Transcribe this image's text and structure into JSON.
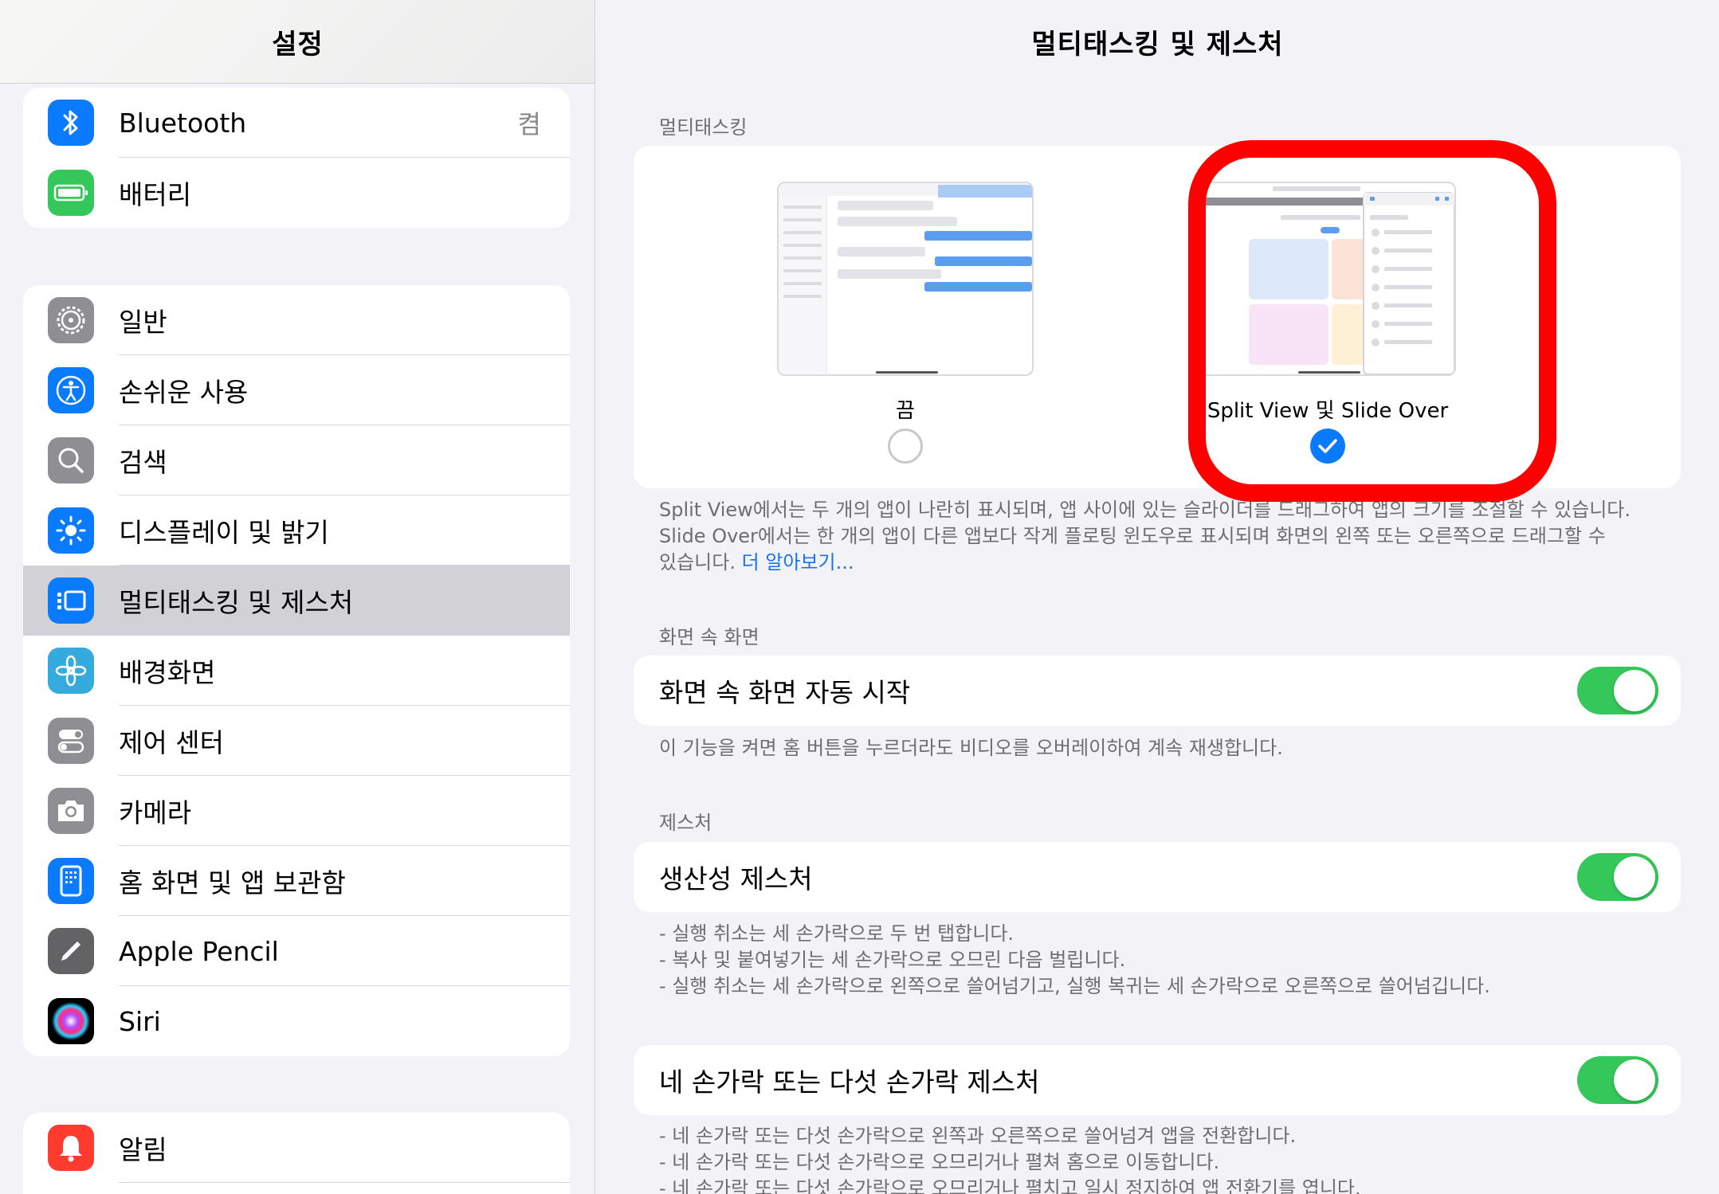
{
  "sidebar": {
    "title": "설정",
    "group1": [
      {
        "label": "Bluetooth",
        "value": "켬",
        "icon": "bluetooth-icon",
        "color": "#0a7aff"
      },
      {
        "label": "배터리",
        "icon": "battery-icon",
        "color": "#34c759"
      }
    ],
    "group2": [
      {
        "label": "일반",
        "icon": "gear-icon",
        "color": "#8e8e93"
      },
      {
        "label": "손쉬운 사용",
        "icon": "accessibility-icon",
        "color": "#0a7aff"
      },
      {
        "label": "검색",
        "icon": "search-icon",
        "color": "#8e8e93"
      },
      {
        "label": "디스플레이 및 밝기",
        "icon": "sun-icon",
        "color": "#0a7aff"
      },
      {
        "label": "멀티태스킹 및 제스처",
        "icon": "multitasking-icon",
        "color": "#0a7aff",
        "selected": true
      },
      {
        "label": "배경화면",
        "icon": "flower-icon",
        "color": "#35aadc"
      },
      {
        "label": "제어 센터",
        "icon": "switches-icon",
        "color": "#8e8e93"
      },
      {
        "label": "카메라",
        "icon": "camera-icon",
        "color": "#8e8e93"
      },
      {
        "label": "홈 화면 및 앱 보관함",
        "icon": "home-screen-icon",
        "color": "#0a7aff"
      },
      {
        "label": "Apple Pencil",
        "icon": "pencil-icon",
        "color": "#636366"
      },
      {
        "label": "Siri",
        "icon": "siri-icon",
        "color": "#000000"
      }
    ],
    "group3": [
      {
        "label": "알림",
        "icon": "bell-icon",
        "color": "#ff3b30"
      }
    ]
  },
  "main": {
    "title": "멀티태스킹 및 제스처",
    "multitasking": {
      "header": "멀티태스킹",
      "option_off_label": "끔",
      "option_split_label": "Split View 및 Slide Over",
      "selected": "split",
      "footer_line1": "Split View에서는 두 개의 앱이 나란히 표시되며, 앱 사이에 있는 슬라이더를 드래그하여 앱의 크기를 조절할 수 있습니다.",
      "footer_line2": "Slide Over에서는 한 개의 앱이 다른 앱보다 작게 플로팅 윈도우로 표시되며 화면의 왼쪽 또는 오른쪽으로 드래그할 수",
      "footer_line3": "있습니다.",
      "learn_more": "더 알아보기..."
    },
    "pip": {
      "header": "화면 속 화면",
      "toggle_label": "화면 속 화면 자동 시작",
      "toggle_on": true,
      "footer": "이 기능을 켜면 홈 버튼을 누르더라도 비디오를 오버레이하여 계속 재생합니다."
    },
    "gestures": {
      "header": "제스처",
      "toggle_label": "생산성 제스처",
      "toggle_on": true,
      "footer_lines": [
        "- 실행 취소는 세 손가락으로 두 번 탭합니다.",
        "- 복사 및 붙여넣기는 세 손가락으로 오므린 다음 벌립니다.",
        "- 실행 취소는 세 손가락으로 왼쪽으로 쓸어넘기고, 실행 복귀는 세 손가락으로 오른쪽으로 쓸어넘깁니다."
      ]
    },
    "four_finger": {
      "toggle_label": "네 손가락 또는 다섯 손가락 제스처",
      "toggle_on": true,
      "footer_lines": [
        "- 네 손가락 또는 다섯 손가락으로 왼쪽과 오른쪽으로 쓸어넘겨 앱을 전환합니다.",
        "- 네 손가락 또는 다섯 손가락으로 오므리거나 펼쳐 홈으로 이동합니다.",
        "- 네 손가락 또는 다섯 손가락으로 오므리거나 펼치고 일시 정지하여 앱 전환기를 엽니다."
      ]
    },
    "highlight_color": "#ff0000",
    "accent_color": "#34c759"
  }
}
